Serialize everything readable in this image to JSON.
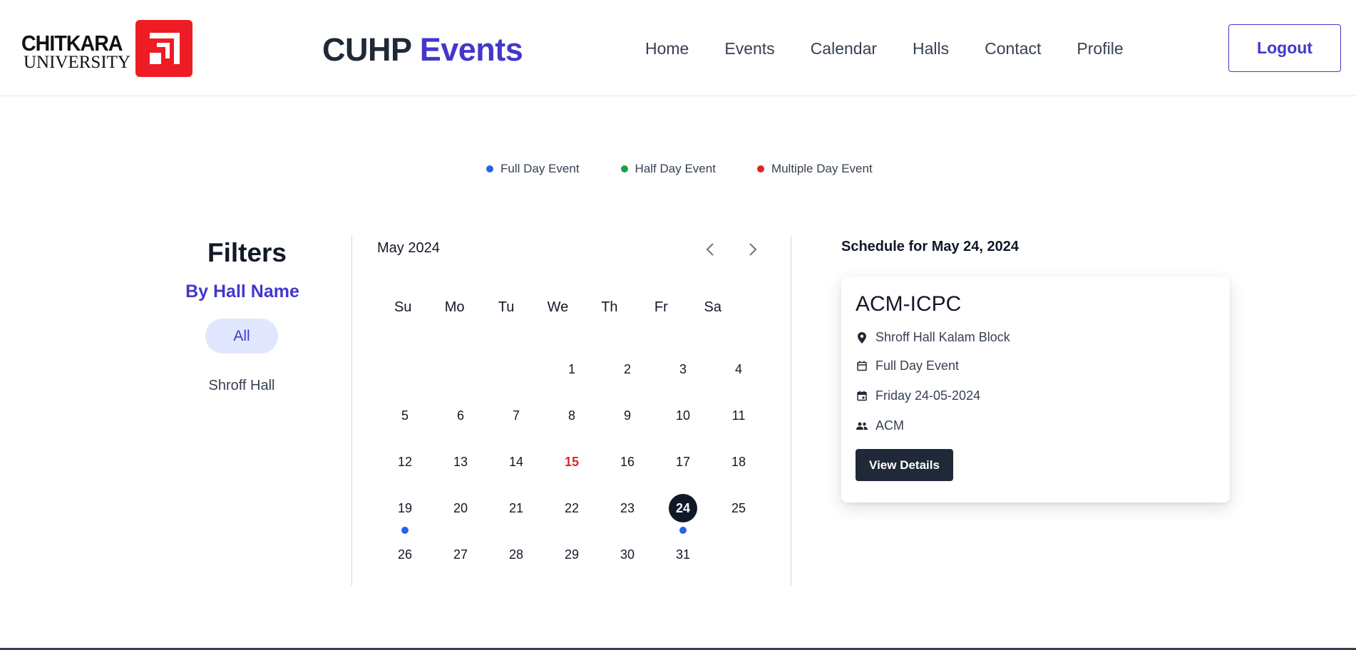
{
  "header": {
    "logo": {
      "line1": "CHITKARA",
      "line2": "UNIVERSITY"
    },
    "brand": {
      "part1": "CUHP ",
      "part2": "Events"
    },
    "nav": [
      "Home",
      "Events",
      "Calendar",
      "Halls",
      "Contact",
      "Profile"
    ],
    "logout_label": "Logout"
  },
  "legend": [
    {
      "label": "Full Day Event",
      "color": "#2563eb"
    },
    {
      "label": "Half Day Event",
      "color": "#16a34a"
    },
    {
      "label": "Multiple Day Event",
      "color": "#dc2626"
    }
  ],
  "filters": {
    "title": "Filters",
    "subtitle": "By Hall Name",
    "active": "All",
    "items": [
      "Shroff Hall"
    ]
  },
  "calendar": {
    "month_label": "May 2024",
    "weekdays": [
      "Su",
      "Mo",
      "Tu",
      "We",
      "Th",
      "Fr",
      "Sa"
    ],
    "first_weekday_index": 3,
    "days_in_month": 31,
    "selected_day": 24,
    "highlight_red_day": 15,
    "event_dot_days": [
      19,
      24
    ],
    "event_dot_color": "#2563eb"
  },
  "schedule": {
    "title": "Schedule for May 24, 2024",
    "card": {
      "event_name": "ACM-ICPC",
      "location": "Shroff Hall Kalam Block",
      "type": "Full Day Event",
      "date": "Friday 24-05-2024",
      "organizer": "ACM",
      "button_label": "View Details"
    }
  },
  "colors": {
    "accent": "#4338ca",
    "dark": "#1f2937",
    "pill_bg": "#e0e7ff",
    "logo_red": "#ee1c24"
  }
}
